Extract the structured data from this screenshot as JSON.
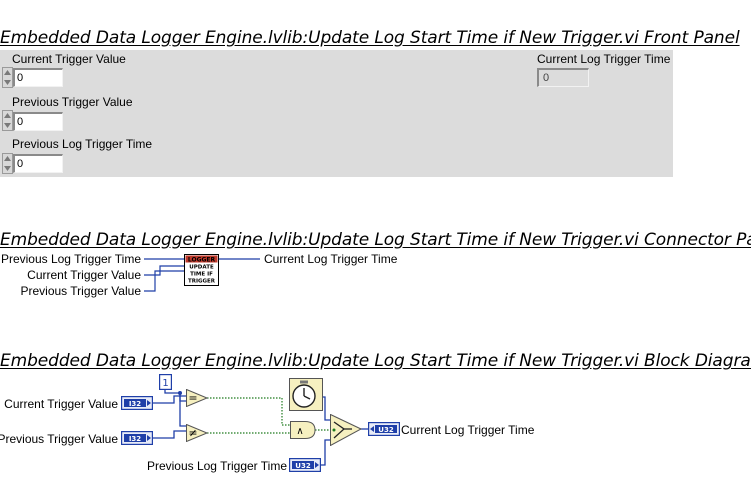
{
  "front_panel": {
    "title": "Embedded Data Logger Engine.lvlib:Update Log Start Time if New Trigger.vi Front Panel",
    "controls": [
      {
        "label": "Current Trigger Value",
        "value": "0"
      },
      {
        "label": "Previous Trigger Value",
        "value": "0"
      },
      {
        "label": "Previous Log Trigger Time",
        "value": "0"
      }
    ],
    "indicator": {
      "label": "Current Log Trigger Time",
      "value": "0"
    }
  },
  "connector_pane": {
    "title": "Embedded Data Logger Engine.lvlib:Update Log Start Time if New Trigger.vi Connector Pane",
    "inputs": [
      "Previous Log Trigger Time",
      "Current Trigger Value",
      "Previous Trigger Value"
    ],
    "output": "Current Log Trigger Time",
    "icon_lines": [
      "LOGGER",
      "UPDATE",
      "TIME IF",
      "TRIGGER"
    ]
  },
  "block_diagram": {
    "title": "Embedded Data Logger Engine.lvlib:Update Log Start Time if New Trigger.vi Block Diagram",
    "terminals": [
      {
        "label": "Current Trigger Value",
        "type": "I32"
      },
      {
        "label": "Previous Trigger Value",
        "type": "I32"
      },
      {
        "label": "Previous Log Trigger Time",
        "type": "U32"
      }
    ],
    "output_terminal": {
      "label": "Current Log Trigger Time",
      "type": "U32"
    },
    "constant": "1",
    "equal_symbol": "=",
    "not_equal_symbol": "≠",
    "and_symbol": "∧"
  },
  "colors": {
    "panel_bg": "#dcdcdc",
    "integer_wire": "#1f3fa8",
    "boolean_wire": "#1e7a1e",
    "node_fill": "#f6f0c0"
  }
}
